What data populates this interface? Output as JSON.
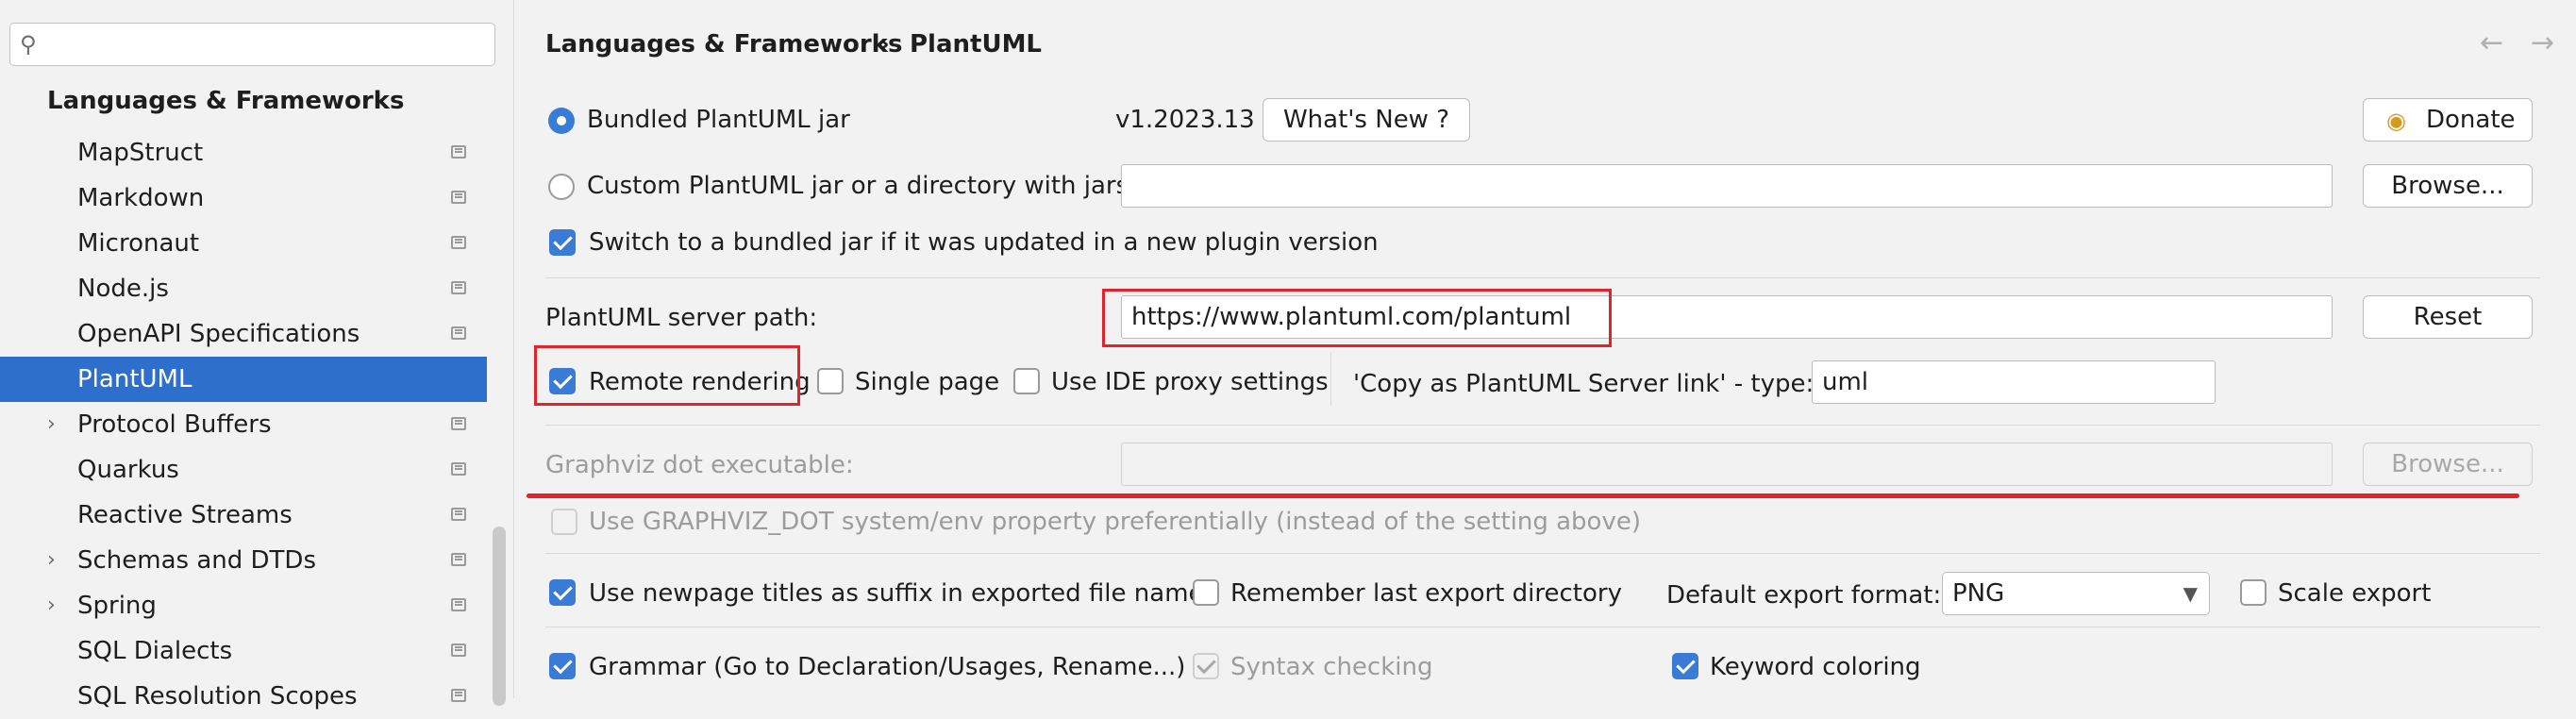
{
  "search": {
    "placeholder": ""
  },
  "sidebar": {
    "section_title": "Languages & Frameworks",
    "items": [
      {
        "label": "MapStruct",
        "expandable": false,
        "selected": false
      },
      {
        "label": "Markdown",
        "expandable": false,
        "selected": false
      },
      {
        "label": "Micronaut",
        "expandable": false,
        "selected": false
      },
      {
        "label": "Node.js",
        "expandable": false,
        "selected": false
      },
      {
        "label": "OpenAPI Specifications",
        "expandable": false,
        "selected": false
      },
      {
        "label": "PlantUML",
        "expandable": false,
        "selected": true
      },
      {
        "label": "Protocol Buffers",
        "expandable": true,
        "selected": false
      },
      {
        "label": "Quarkus",
        "expandable": false,
        "selected": false
      },
      {
        "label": "Reactive Streams",
        "expandable": false,
        "selected": false
      },
      {
        "label": "Schemas and DTDs",
        "expandable": true,
        "selected": false
      },
      {
        "label": "Spring",
        "expandable": true,
        "selected": false
      },
      {
        "label": "SQL Dialects",
        "expandable": false,
        "selected": false
      },
      {
        "label": "SQL Resolution Scopes",
        "expandable": false,
        "selected": false
      }
    ]
  },
  "breadcrumb": {
    "parent": "Languages & Frameworks",
    "separator": "›",
    "current": "PlantUML"
  },
  "nav": {
    "back": "←",
    "forward": "→"
  },
  "jar": {
    "bundled_label": "Bundled PlantUML jar",
    "version": "v1.2023.13",
    "whats_new": "What's New ?",
    "donate": "Donate",
    "custom_label": "Custom PlantUML jar or a directory with jars:",
    "custom_value": "",
    "browse": "Browse...",
    "switch_label": "Switch to a bundled jar if it was updated in a new plugin version"
  },
  "server": {
    "path_label": "PlantUML server path:",
    "path_value": "https://www.plantuml.com/plantuml",
    "reset": "Reset",
    "remote_rendering": "Remote rendering",
    "single_page": "Single page",
    "proxy": "Use IDE proxy settings",
    "copy_type_label": "'Copy as PlantUML Server link' - type:",
    "copy_type_value": "uml"
  },
  "graphviz": {
    "label": "Graphviz dot executable:",
    "value": "",
    "browse": "Browse...",
    "env_label": "Use GRAPHVIZ_DOT system/env property preferentially (instead of the setting above)"
  },
  "export": {
    "newpage_label": "Use newpage titles as suffix in exported file names",
    "remember_label": "Remember last export directory",
    "format_label": "Default export format:",
    "format_value": "PNG",
    "scale_label": "Scale export"
  },
  "editor": {
    "grammar_label": "Grammar (Go to Declaration/Usages, Rename...)",
    "syntax_label": "Syntax checking",
    "keyword_label": "Keyword coloring"
  },
  "colors": {
    "accent": "#3a7bd5",
    "selection": "#2d6fcb",
    "annotation": "#e0242a"
  }
}
